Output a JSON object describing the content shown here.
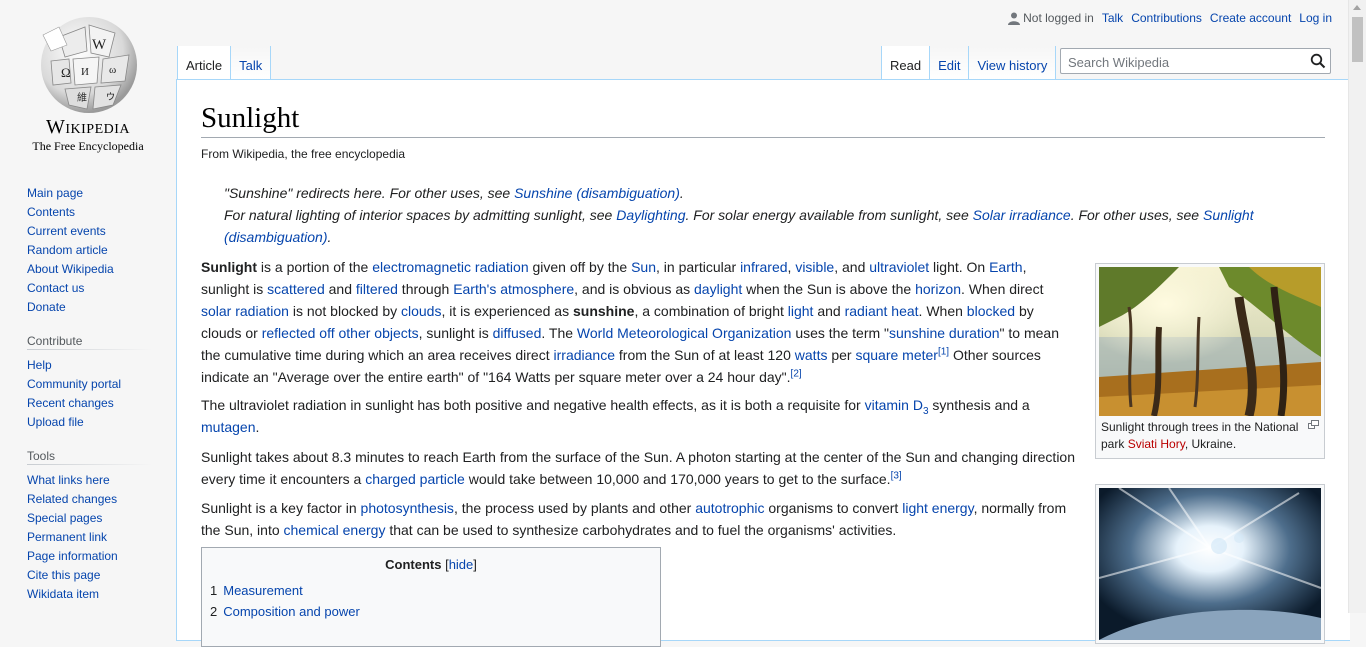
{
  "logo": {
    "wordmark": "Wikipedia",
    "tagline": "The Free Encyclopedia"
  },
  "navigation": {
    "main": [
      "Main page",
      "Contents",
      "Current events",
      "Random article",
      "About Wikipedia",
      "Contact us",
      "Donate"
    ],
    "contribute": {
      "heading": "Contribute",
      "items": [
        "Help",
        "Community portal",
        "Recent changes",
        "Upload file"
      ]
    },
    "tools": {
      "heading": "Tools",
      "items": [
        "What links here",
        "Related changes",
        "Special pages",
        "Permanent link",
        "Page information",
        "Cite this page",
        "Wikidata item"
      ]
    }
  },
  "personal": {
    "status": "Not logged in",
    "talk": "Talk",
    "contributions": "Contributions",
    "create_account": "Create account",
    "login": "Log in"
  },
  "tabs": {
    "article": "Article",
    "talk": "Talk",
    "read": "Read",
    "edit": "Edit",
    "history": "View history"
  },
  "search": {
    "placeholder": "Search Wikipedia"
  },
  "article": {
    "title": "Sunlight",
    "tagline": "From Wikipedia, the free encyclopedia",
    "hatnote1": {
      "prefix": "\"Sunshine\" redirects here. For other uses, see ",
      "link": "Sunshine (disambiguation)",
      "suffix": "."
    },
    "hatnote2": {
      "t1": "For natural lighting of interior spaces by admitting sunlight, see ",
      "l1": "Daylighting",
      "t2": ". For solar energy available from sunlight, see ",
      "l2": "Solar irradiance",
      "t3": ". For other uses, see ",
      "l3": "Sunlight (disambiguation)",
      "t4": "."
    }
  },
  "thumb1": {
    "caption_pre": "Sunlight through trees in the National park ",
    "caption_link": "Sviati Hory",
    "caption_post": ", Ukraine."
  },
  "toc": {
    "title": "Contents",
    "hide": "hide",
    "items": [
      {
        "num": "1",
        "label": "Measurement"
      },
      {
        "num": "2",
        "label": "Composition and power"
      }
    ]
  },
  "colors": {
    "link": "#0645ad",
    "redlink": "#ba0000",
    "border": "#a7d7f9"
  },
  "icons": [
    "user-icon",
    "search-icon",
    "magnify-icon"
  ]
}
